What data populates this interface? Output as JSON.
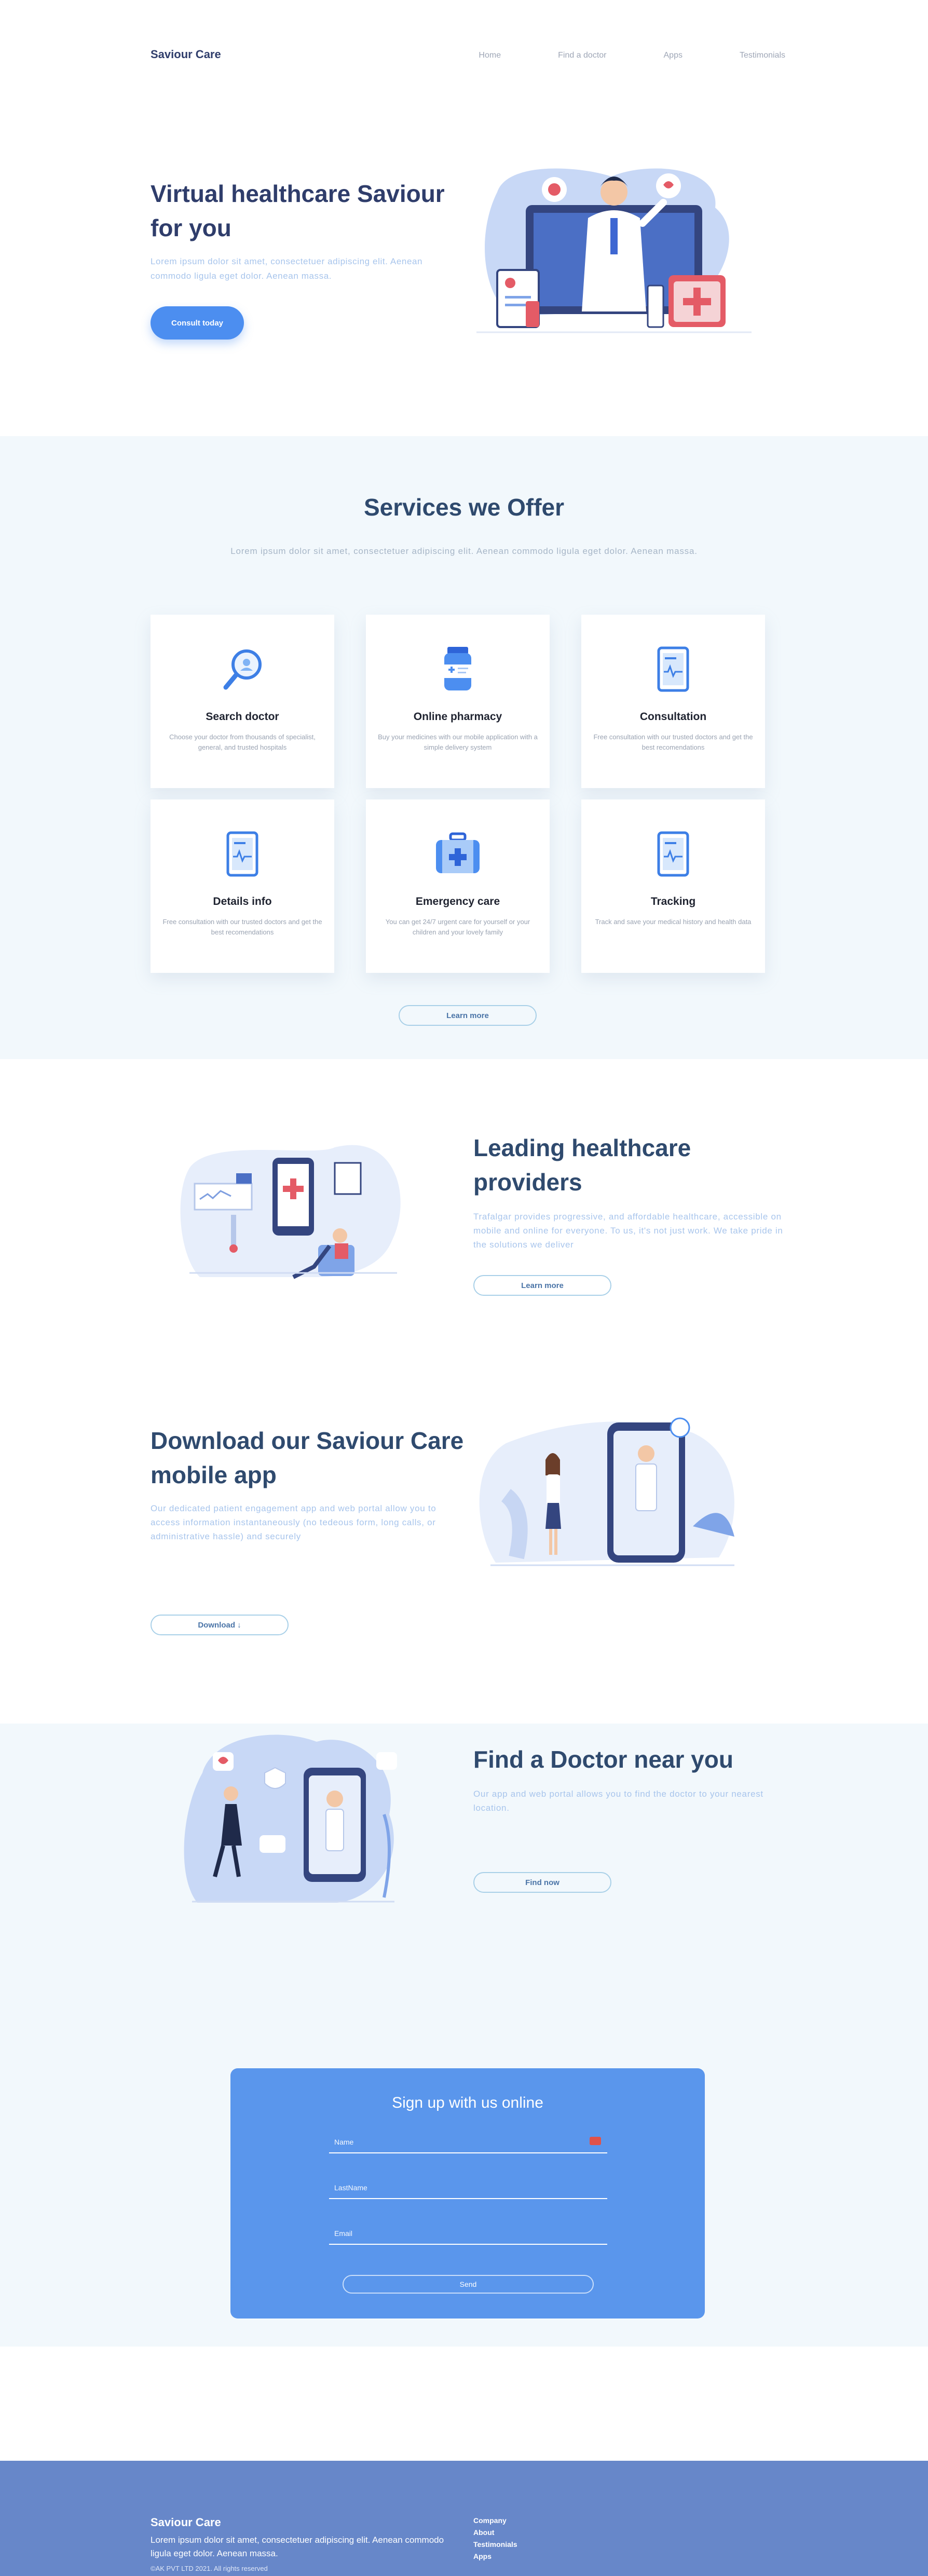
{
  "nav": {
    "brand": "Saviour Care",
    "links": [
      "Home",
      "Find a doctor",
      "Apps",
      "Testimonials"
    ]
  },
  "hero": {
    "title": "Virtual healthcare Saviour for you",
    "subtitle": "Lorem ipsum dolor sit amet, consectetuer adipiscing elit. Aenean commodo ligula eget dolor. Aenean massa.",
    "cta": "Consult today"
  },
  "services": {
    "title": "Services we Offer",
    "subtitle": "Lorem ipsum dolor sit amet, consectetuer adipiscing elit. Aenean commodo ligula eget dolor. Aenean massa.",
    "cards": [
      {
        "title": "Search doctor",
        "desc": "Choose your doctor from thousands of specialist, general, and trusted hospitals",
        "icon": "magnifier-icon"
      },
      {
        "title": "Online pharmacy",
        "desc": "Buy your medicines with our mobile application with a simple delivery system",
        "icon": "medicine-bottle-icon"
      },
      {
        "title": "Consultation",
        "desc": "Free consultation with our trusted doctors and get the best recomendations",
        "icon": "clipboard-icon"
      },
      {
        "title": "Details info",
        "desc": "Free consultation with our trusted doctors and get the best recomendations",
        "icon": "clipboard-icon"
      },
      {
        "title": "Emergency care",
        "desc": "You can get 24/7 urgent care for yourself or your children and your lovely family",
        "icon": "first-aid-kit-icon"
      },
      {
        "title": "Tracking",
        "desc": "Track and save your medical history and health data",
        "icon": "clipboard-icon"
      }
    ],
    "learn_more": "Learn more"
  },
  "providers": {
    "title": "Leading healthcare providers",
    "text": "Trafalgar provides progressive, and affordable healthcare, accessible on mobile and online for everyone. To us, it's not just work. We take pride in the solutions we deliver",
    "button": "Learn more"
  },
  "app": {
    "title": "Download our Saviour Care mobile app",
    "text": "Our dedicated patient engagement app and web portal allow you to access information instantaneously (no tedeous form, long calls, or administrative hassle) and securely",
    "button": "Download ↓"
  },
  "find": {
    "title": "Find a Doctor near you",
    "text": "Our app and web portal allows you to find the doctor to your nearest location.",
    "button": "Find now"
  },
  "signup": {
    "title": "Sign up with us online",
    "name_placeholder": "Name",
    "lastname_placeholder": "LastName",
    "email_placeholder": "Email",
    "button": "Send"
  },
  "footer": {
    "brand": "Saviour Care",
    "text": "Lorem ipsum dolor sit amet, consectetuer adipiscing elit. Aenean commodo ligula eget dolor. Aenean massa.",
    "copyright": "©AK PVT LTD 2021. All rights reserved",
    "links": [
      "Company",
      "About",
      "Testimonials",
      "Apps"
    ]
  },
  "colors": {
    "primary": "#4c8ef0",
    "heading": "#2f4a6e",
    "section_bg": "#f2f8fc",
    "signup_bg": "#5a96ec",
    "footer_bg": "#6787c9"
  }
}
